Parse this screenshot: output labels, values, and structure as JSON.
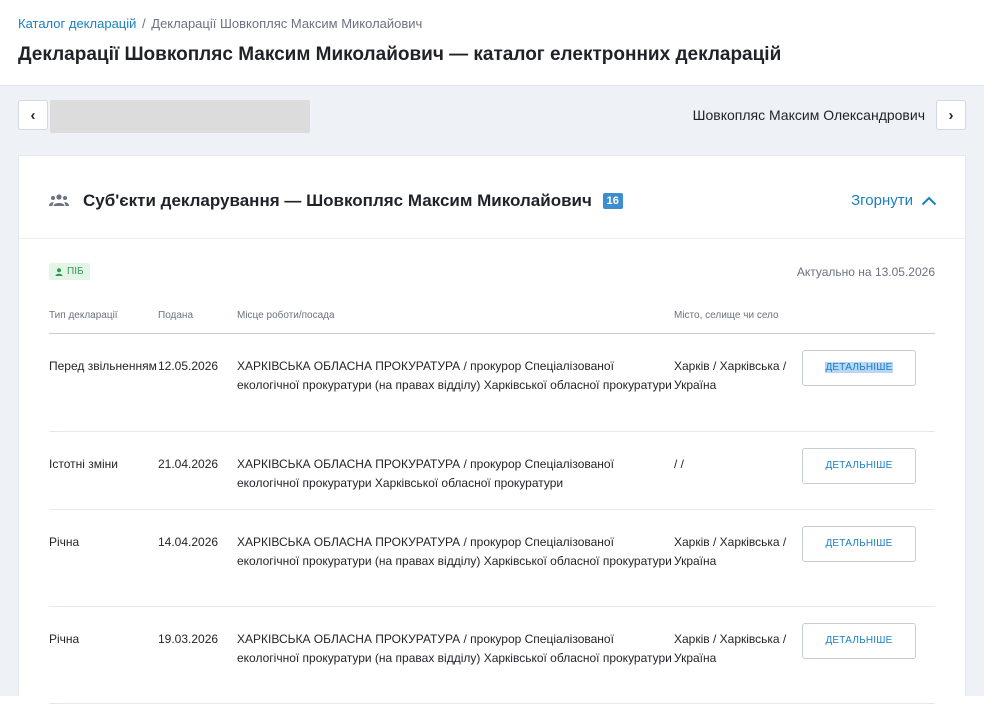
{
  "breadcrumb": {
    "root": "Каталог декларацій",
    "separator": "/",
    "current": "Декларації Шовкопляс Максим Миколайович"
  },
  "page_title": "Декларації Шовкопляс Максим Миколайович — каталог електронних декларацій",
  "nav": {
    "prev_icon": "‹",
    "next_icon": "›",
    "next_name": "Шовкопляс Максим Олександрович"
  },
  "card": {
    "title": "Суб'єкти декларування — Шовкопляс Максим Миколайович",
    "count": "16",
    "collapse_label": "Згорнути",
    "pib_badge": "ПІБ",
    "actual_date": "Актуально на 13.05.2026",
    "columns": [
      "Тип декларації",
      "Подана",
      "Місце роботи/посада",
      "Місто, селище чи село"
    ],
    "rows": [
      {
        "type": "Перед звільненням",
        "date": "12.05.2026",
        "workplace": "ХАРКІВСЬКА ОБЛАСНА ПРОКУРАТУРА / прокурор Спеціалізованої екологічної прокуратури (на правах відділу) Харківської обласної прокуратури",
        "city": "Харків / Харківська / Україна",
        "button": "ДЕТАЛЬНІШЕ"
      },
      {
        "type": "Істотні зміни",
        "date": "21.04.2026",
        "workplace": "ХАРКІВСЬКА ОБЛАСНА ПРОКУРАТУРА / прокурор Спеціалізованої екологічної прокуратури Харківської обласної прокуратури",
        "city": "/ /",
        "button": "ДЕТАЛЬНІШЕ"
      },
      {
        "type": "Річна",
        "date": "14.04.2026",
        "workplace": "ХАРКІВСЬКА ОБЛАСНА ПРОКУРАТУРА / прокурор Спеціалізованої екологічної прокуратури (на правах відділу) Харківської обласної прокуратури",
        "city": "Харків / Харківська / Україна",
        "button": "ДЕТАЛЬНІШЕ"
      },
      {
        "type": "Річна",
        "date": "19.03.2026",
        "workplace": "ХАРКІВСЬКА ОБЛАСНА ПРОКУРАТУРА / прокурор Спеціалізованої екологічної прокуратури (на правах відділу) Харківської обласної прокуратури",
        "city": "Харків / Харківська / Україна",
        "button": "ДЕТАЛЬНІШЕ"
      }
    ]
  },
  "colors": {
    "accent": "#1a7fc1",
    "badge_blue": "#3d8ed0",
    "badge_green_bg": "#e4f5e8",
    "badge_green_text": "#2e9b50",
    "page_bg": "#eef1f6"
  }
}
